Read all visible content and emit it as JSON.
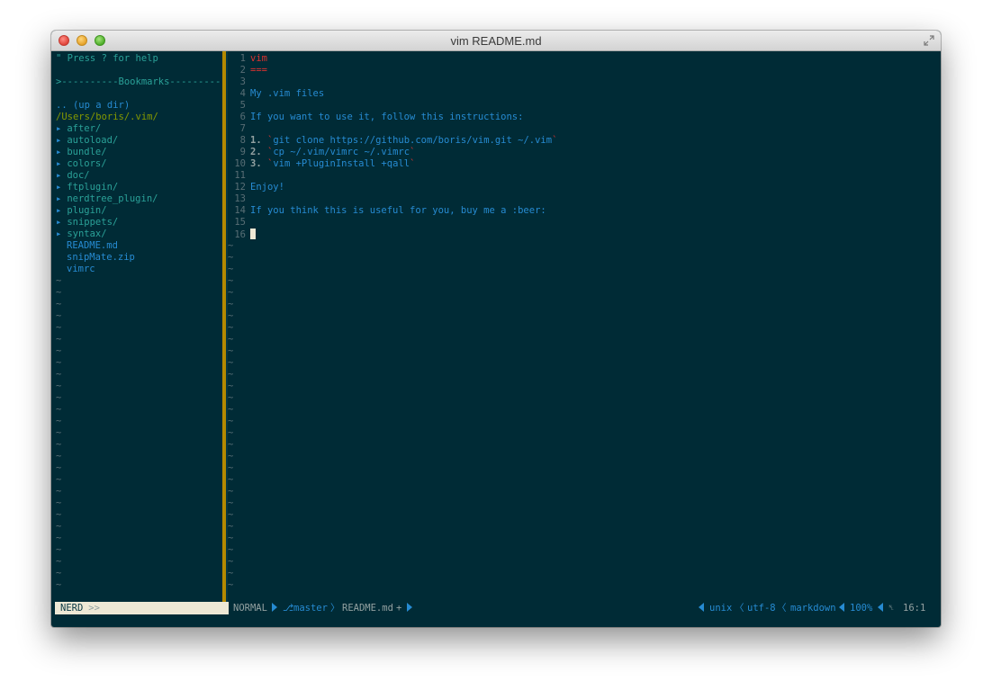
{
  "window": {
    "title": "vim README.md"
  },
  "nerdtree": {
    "help": "\" Press ? for help",
    "bookmarks": ">----------Bookmarks----------",
    "up_dir": ".. (up a dir)",
    "cwd": "/Users/boris/.vim/",
    "dirs": [
      "after/",
      "autoload/",
      "bundle/",
      "colors/",
      "doc/",
      "ftplugin/",
      "nerdtree_plugin/",
      "plugin/",
      "snippets/",
      "syntax/"
    ],
    "files": [
      "README.md",
      "snipMate.zip",
      "vimrc"
    ],
    "dir_marker": "▸",
    "tilde": "~"
  },
  "editor": {
    "lines": [
      {
        "n": "1",
        "text": "vim"
      },
      {
        "n": "2",
        "text": "==="
      },
      {
        "n": "3",
        "text": ""
      },
      {
        "n": "4",
        "text": "My .vim files"
      },
      {
        "n": "5",
        "text": ""
      },
      {
        "n": "6",
        "text": "If you want to use it, follow this instructions:"
      },
      {
        "n": "7",
        "text": ""
      },
      {
        "n": "8",
        "list": "1.",
        "code": "`git clone https://github.com/boris/vim.git ~/.vim`"
      },
      {
        "n": "9",
        "list": "2.",
        "code": "`cp ~/.vim/vimrc ~/.vimrc`"
      },
      {
        "n": "10",
        "list": "3.",
        "code": "`vim +PluginInstall +qall`"
      },
      {
        "n": "11",
        "text": ""
      },
      {
        "n": "12",
        "text": "Enjoy!"
      },
      {
        "n": "13",
        "text": ""
      },
      {
        "n": "14",
        "text": "If you think this is useful for you, buy me a :beer:"
      },
      {
        "n": "15",
        "text": ""
      },
      {
        "n": "16",
        "text": ""
      }
    ],
    "tilde": "~"
  },
  "statusline": {
    "nerd_label": "NERD",
    "nerd_sep": ">>",
    "mode": "NORMAL",
    "branch_icon": "⎇",
    "branch": "master",
    "filename": "README.md",
    "modified": "+",
    "fileformat": "unix",
    "encoding": "utf-8",
    "filetype": "markdown",
    "percent": "100%",
    "ln_icon": "␤",
    "position": "16:1"
  },
  "colors": {
    "background": "#002b36",
    "heading": "#dc322f",
    "text": "#268bd2",
    "dir": "#2aa198",
    "cwd": "#b58900"
  }
}
